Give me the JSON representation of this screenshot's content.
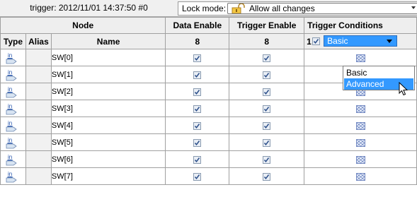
{
  "toolbar": {
    "trigger_label": "trigger: 2012/11/01 14:37:50  #0",
    "lock_mode_label": "Lock mode:",
    "lock_mode_value": "Allow all changes"
  },
  "table": {
    "group_header_node": "Node",
    "col_data_enable": "Data Enable",
    "col_trigger_enable": "Trigger Enable",
    "col_trigger_conditions": "Trigger Conditions",
    "col_type": "Type",
    "col_alias": "Alias",
    "col_name": "Name",
    "data_enable_count": "8",
    "trigger_enable_count": "8",
    "trigger_condition_count": "1",
    "trigger_condition_selected": "Basic",
    "rows": [
      {
        "type": "in",
        "name": "SW[0]"
      },
      {
        "type": "in",
        "name": "SW[1]"
      },
      {
        "type": "in",
        "name": "SW[2]"
      },
      {
        "type": "in",
        "name": "SW[3]"
      },
      {
        "type": "in",
        "name": "SW[4]"
      },
      {
        "type": "in",
        "name": "SW[5]"
      },
      {
        "type": "in",
        "name": "SW[6]"
      },
      {
        "type": "in",
        "name": "SW[7]"
      }
    ]
  },
  "dropdown": {
    "options": [
      "Basic",
      "Advanced"
    ],
    "highlighted": "Advanced"
  },
  "colors": {
    "selection_blue": "#3399ff",
    "header_gray": "#eeeeee",
    "grid_line": "#a0a0a0"
  }
}
